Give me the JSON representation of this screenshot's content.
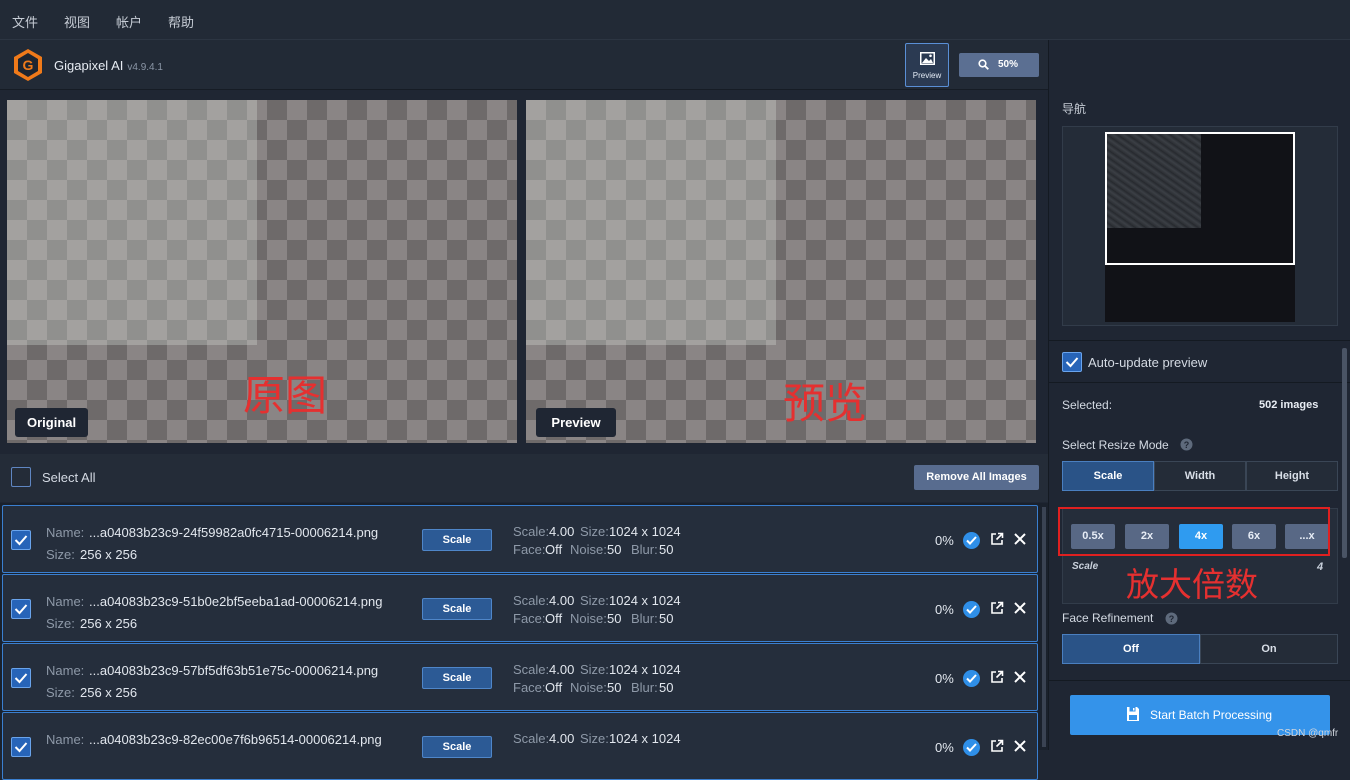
{
  "menu": [
    "文件",
    "视图",
    "帐户",
    "帮助"
  ],
  "app": {
    "name": "Gigapixel AI",
    "version": "v4.9.4.1"
  },
  "toolbar": {
    "preview_label": "Preview",
    "zoom_label": "50%"
  },
  "canvases": {
    "original_tag": "Original",
    "preview_tag": "Preview",
    "anno_original": "原图",
    "anno_preview": "预览"
  },
  "list_header": {
    "select_all": "Select All",
    "remove_all": "Remove All Images"
  },
  "rows": [
    {
      "name_label": "Name:",
      "name": "...a04083b23c9-24f59982a0fc4715-00006214.png",
      "size_label": "Size:",
      "size": "256 x 256",
      "mode": "Scale",
      "scale_label": "Scale:",
      "scale": "4.00",
      "osize_label": "Size:",
      "osize": "1024 x 1024",
      "face_label": "Face:",
      "face": "Off",
      "noise_label": "Noise:",
      "noise": "50",
      "blur_label": "Blur:",
      "blur": "50",
      "progress": "0%"
    },
    {
      "name_label": "Name:",
      "name": "...a04083b23c9-51b0e2bf5eeba1ad-00006214.png",
      "size_label": "Size:",
      "size": "256 x 256",
      "mode": "Scale",
      "scale_label": "Scale:",
      "scale": "4.00",
      "osize_label": "Size:",
      "osize": "1024 x 1024",
      "face_label": "Face:",
      "face": "Off",
      "noise_label": "Noise:",
      "noise": "50",
      "blur_label": "Blur:",
      "blur": "50",
      "progress": "0%"
    },
    {
      "name_label": "Name:",
      "name": "...a04083b23c9-57bf5df63b51e75c-00006214.png",
      "size_label": "Size:",
      "size": "256 x 256",
      "mode": "Scale",
      "scale_label": "Scale:",
      "scale": "4.00",
      "osize_label": "Size:",
      "osize": "1024 x 1024",
      "face_label": "Face:",
      "face": "Off",
      "noise_label": "Noise:",
      "noise": "50",
      "blur_label": "Blur:",
      "blur": "50",
      "progress": "0%"
    },
    {
      "name_label": "Name:",
      "name": "...a04083b23c9-82ec00e7f6b96514-00006214.png",
      "mode": "Scale",
      "scale_label": "Scale:",
      "scale": "4.00",
      "osize_label": "Size:",
      "osize": "1024 x 1024",
      "progress": "0%"
    }
  ],
  "panel": {
    "nav_title": "导航",
    "auto_update": "Auto-update preview",
    "selected_label": "Selected:",
    "selected_value": "502 images",
    "resize_mode_title": "Select Resize Mode",
    "resize_modes": [
      "Scale",
      "Width",
      "Height"
    ],
    "resize_mode_active": "Scale",
    "scale_options": [
      "0.5x",
      "2x",
      "4x",
      "6x",
      "...x"
    ],
    "scale_active": "4x",
    "scale_caption": "Scale",
    "scale_value": "4",
    "scale_annotation": "放大倍数",
    "face_refinement_title": "Face Refinement",
    "face_options": [
      "Off",
      "On"
    ],
    "face_active": "Off",
    "start_label": "Start Batch Processing"
  },
  "watermark": "CSDN @qmfr",
  "colors": {
    "accent": "#3493ea",
    "annotation": "#e02020",
    "background": "#1f2633"
  },
  "icons": {
    "logo": "gigapixel-logo-icon",
    "preview": "image-icon",
    "zoom": "magnifier-icon",
    "help": "question-icon",
    "check": "check-icon",
    "open": "external-link-icon",
    "close": "close-icon",
    "save": "floppy-icon"
  }
}
